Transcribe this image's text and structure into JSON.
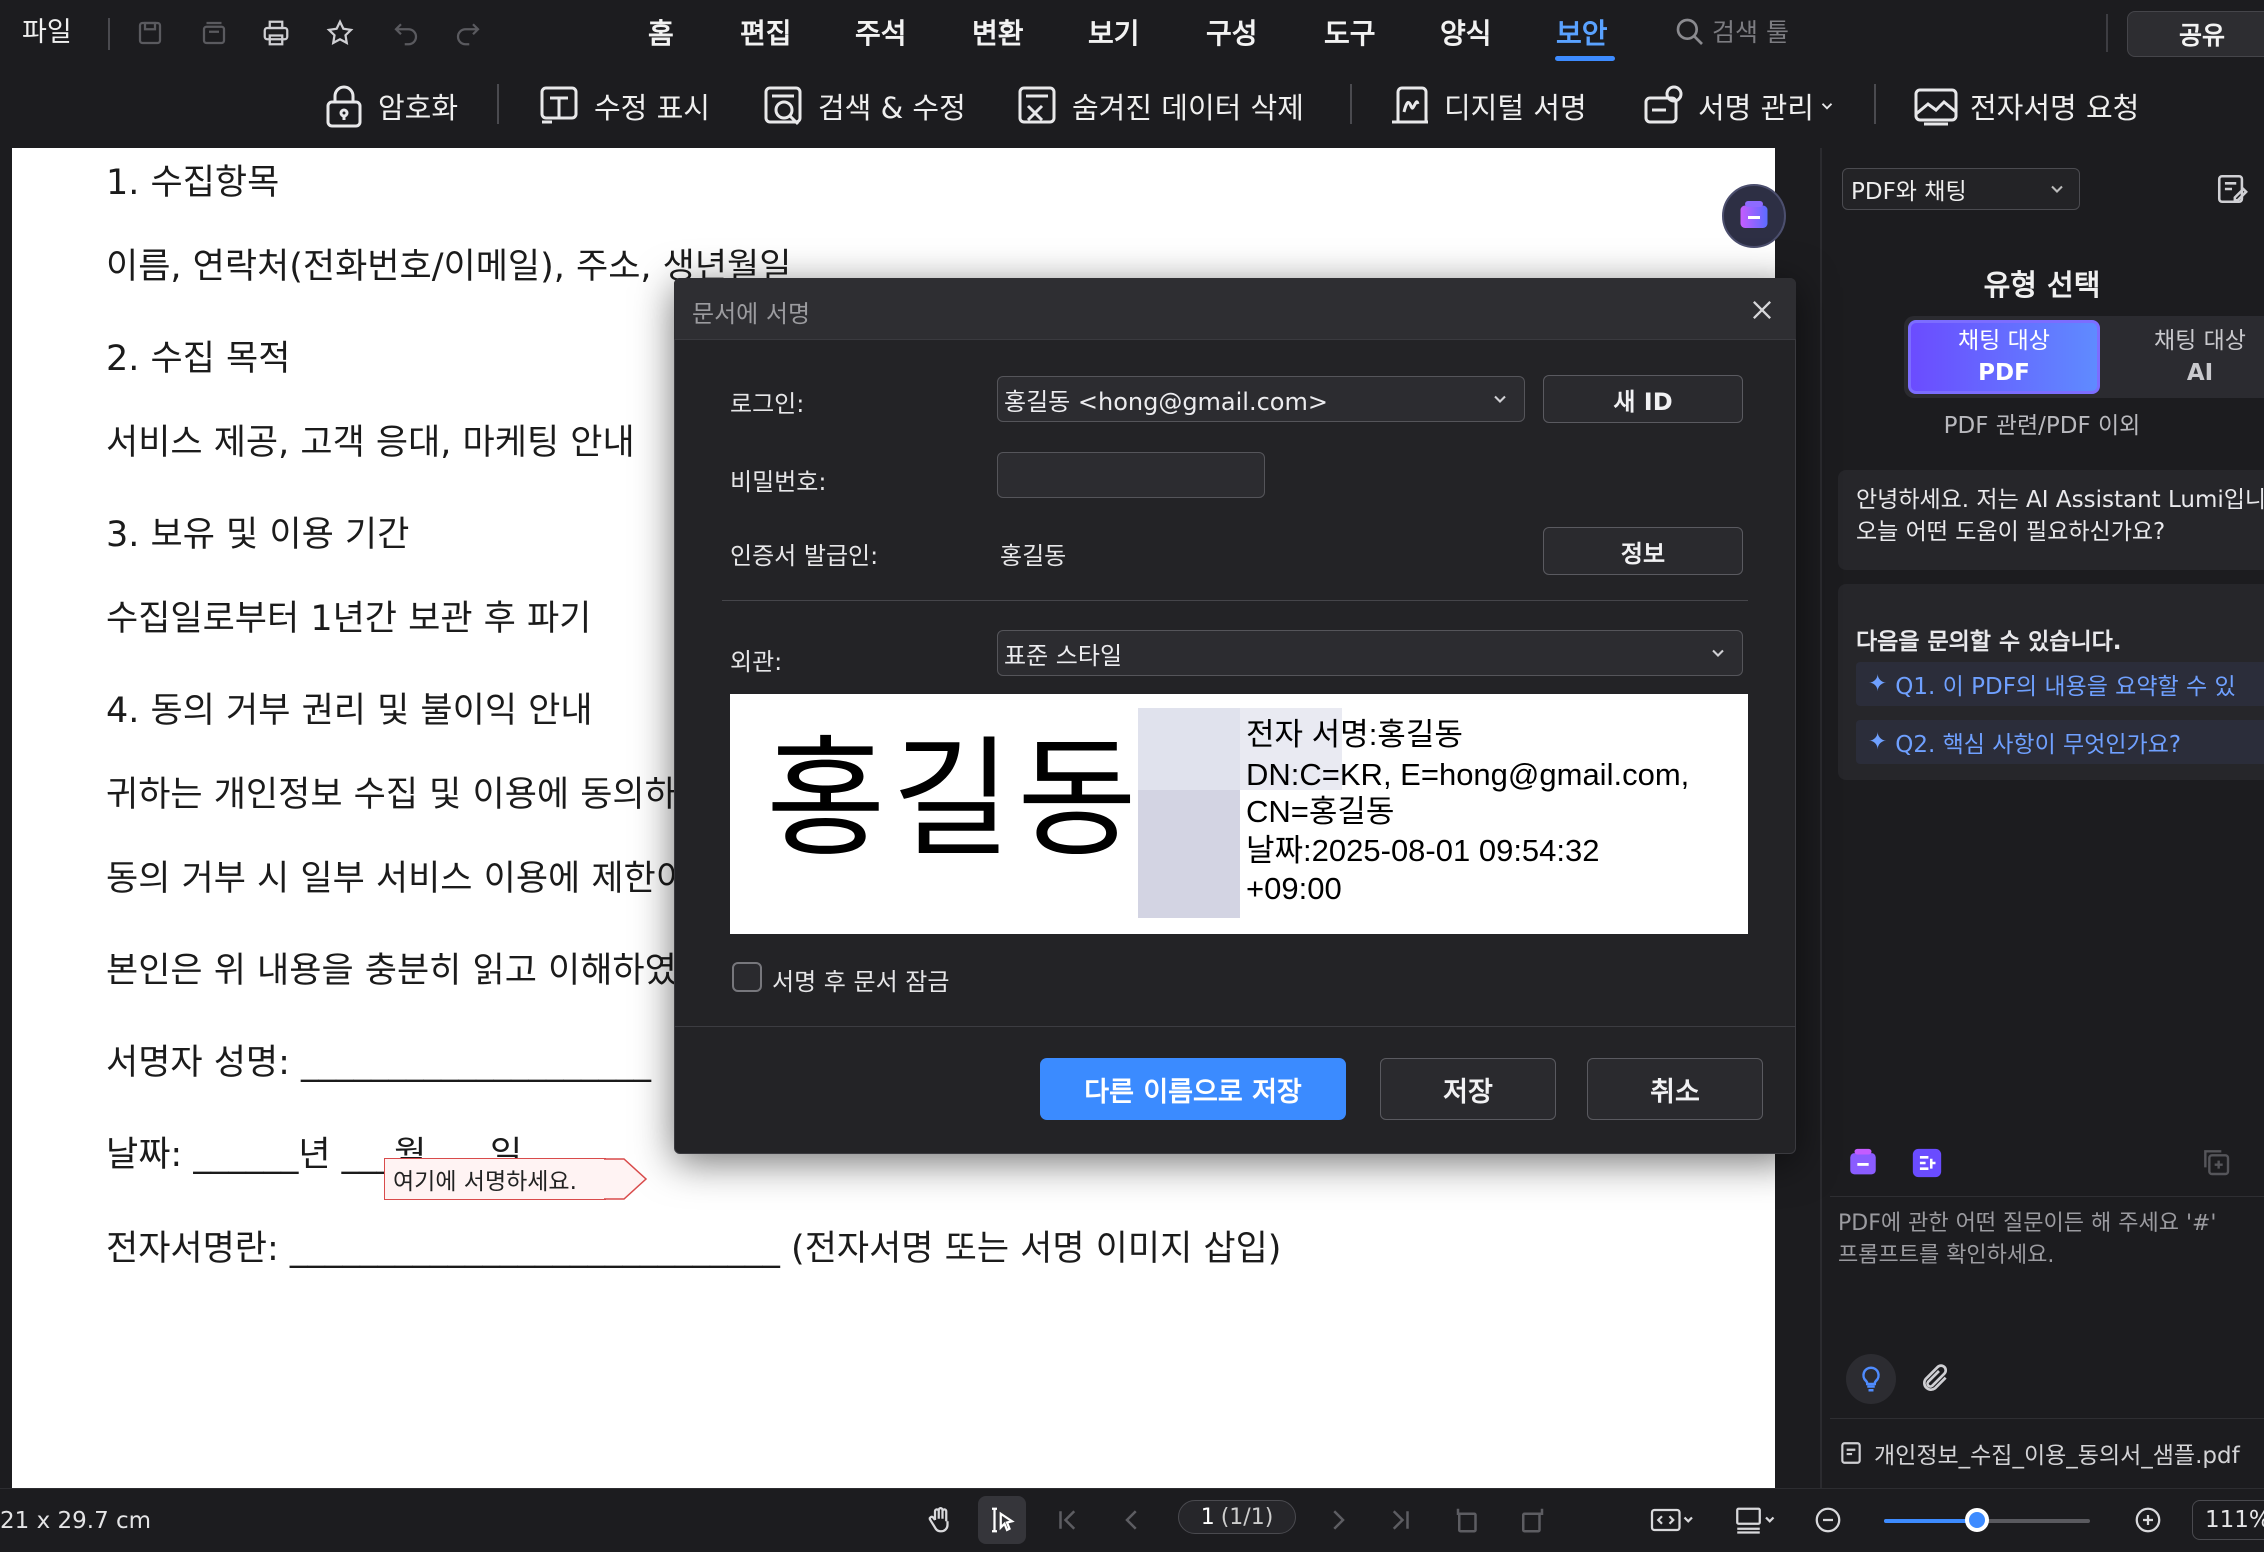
{
  "menubar": {
    "file": "파일",
    "tabs": [
      {
        "label": "홈"
      },
      {
        "label": "편집"
      },
      {
        "label": "주석"
      },
      {
        "label": "변환"
      },
      {
        "label": "보기"
      },
      {
        "label": "구성"
      },
      {
        "label": "도구"
      },
      {
        "label": "양식"
      },
      {
        "label": "보안"
      }
    ],
    "active_tab": "보안",
    "search_placeholder": "검색 툴",
    "share": "공유"
  },
  "ribbon": {
    "items": [
      {
        "label": "암호화",
        "icon": "lock-icon"
      },
      {
        "label": "수정 표시",
        "icon": "redact-mark-icon"
      },
      {
        "label": "검색 & 수정",
        "icon": "search-redact-icon"
      },
      {
        "label": "숨겨진 데이터 삭제",
        "icon": "remove-hidden-data-icon"
      },
      {
        "label": "디지털 서명",
        "icon": "digital-signature-icon"
      },
      {
        "label": "서명 관리",
        "icon": "manage-signature-icon"
      },
      {
        "label": "전자서명 요청",
        "icon": "esign-request-icon"
      }
    ]
  },
  "document": {
    "lines": [
      "1. 수집항목",
      "이름, 연락처(전화번호/이메일), 주소, 생년월일",
      "2. 수집 목적",
      "서비스 제공, 고객 응대, 마케팅 안내",
      "3. 보유 및 이용 기간",
      "수집일로부터 1년간 보관 후 파기",
      "4. 동의 거부 권리 및 불이익 안내",
      "귀하는 개인정보 수집 및 이용에 동의하",
      "동의 거부 시 일부 서비스 이용에 제한이",
      "본인은 위 내용을 충분히 읽고 이해하였",
      "서명자 성명: ____________________",
      "날짜: ______년 ___월 ___일",
      "전자서명란: ____________________________ (전자서명 또는 서명 이미지 삽입)"
    ],
    "sign_here_tag": "여기에 서명하세요."
  },
  "dialog": {
    "title": "문서에 서명",
    "login_label": "로그인:",
    "login_value": "홍길동 <hong@gmail.com>",
    "new_id": "새 ID",
    "password_label": "비밀번호:",
    "password_value": "",
    "issuer_label": "인증서 발급인:",
    "issuer_value": "홍길동",
    "info": "정보",
    "appearance_label": "외관:",
    "appearance_value": "표준 스타일",
    "preview": {
      "name": "홍길동",
      "lines": [
        "전자 서명:홍길동",
        "DN:C=KR, E=hong@gmail.com,",
        "CN=홍길동",
        "날짜:2025-08-01 09:54:32",
        "+09:00"
      ]
    },
    "lock_after_sign": "서명 후 문서 잠금",
    "lock_checked": false,
    "save_as": "다른 이름으로 저장",
    "save": "저장",
    "cancel": "취소"
  },
  "panel": {
    "mode_select": "PDF와 채팅",
    "heading": "유형 선택",
    "chat_pdf": {
      "line1": "채팅 대상",
      "line2": "PDF"
    },
    "chat_ai": {
      "line1": "채팅 대상",
      "line2": "AI"
    },
    "subtitle": "PDF 관련/PDF 이외",
    "greeting_line1": "안녕하세요. 저는 AI Assistant Lumi입니",
    "greeting_line2": "오늘 어떤 도움이 필요하신가요?",
    "suggest_title": "다음을 문의할 수 있습니다.",
    "questions": [
      "Q1. 이 PDF의 내용을 요약할 수 있",
      "Q2. 핵심 사항이 무엇인가요?"
    ],
    "input_hint_line1": "PDF에 관한 어떤 질문이든 해 주세요 '#'",
    "input_hint_line2": "프롬프트를 확인하세요.",
    "file_name": "개인정보_수집_이용_동의서_샘플.pdf"
  },
  "statusbar": {
    "page_size": "21 x 29.7 cm",
    "page_current": "1",
    "page_total": "(1/1)",
    "zoom": "111%",
    "zoom_fraction": 0.45
  },
  "colors": {
    "accent": "#3b8bff",
    "active_tab": "#5aa2ff",
    "sign_tag_border": "#d94b4b"
  }
}
